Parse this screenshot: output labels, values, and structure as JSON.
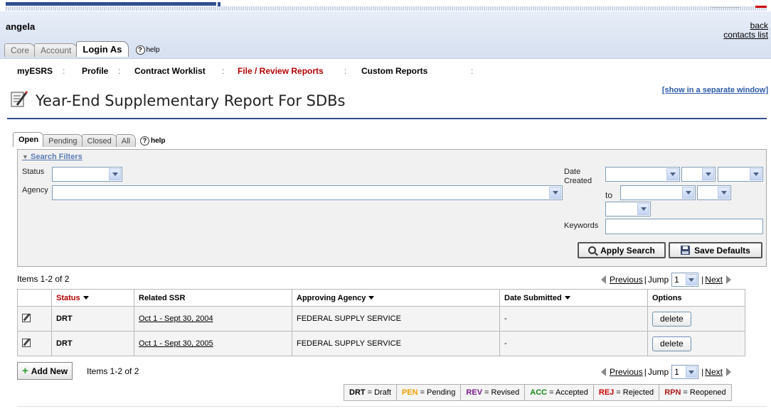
{
  "header": {
    "user_name": "angela",
    "back": "back",
    "contacts_list": "contacts list",
    "tabs": [
      {
        "label": "Core"
      },
      {
        "label": "Account"
      },
      {
        "label": "Login As"
      }
    ],
    "help": "help"
  },
  "nav": {
    "items": [
      {
        "label": "myESRS"
      },
      {
        "label": "Profile"
      },
      {
        "label": "Contract Worklist"
      },
      {
        "label": "File / Review Reports"
      },
      {
        "label": "Custom Reports"
      }
    ],
    "separator": ":"
  },
  "page": {
    "title": "Year-End Supplementary Report For SDBs",
    "separate_window": "[show in a separate window]"
  },
  "subtabs": {
    "items": [
      {
        "label": "Open"
      },
      {
        "label": "Pending"
      },
      {
        "label": "Closed"
      },
      {
        "label": "All"
      }
    ],
    "help": "help"
  },
  "filters": {
    "toggle": "Search Filters",
    "status_label": "Status",
    "agency_label": "Agency",
    "date_created_label": "Date Created",
    "to_label": "to",
    "keywords_label": "Keywords",
    "apply_search": "Apply Search",
    "save_defaults": "Save Defaults"
  },
  "pager": {
    "items_count": "Items 1-2 of 2",
    "previous": "Previous",
    "jump": "Jump",
    "jump_value": "1",
    "next": "Next"
  },
  "table": {
    "headers": {
      "status": "Status",
      "related_ssr": "Related SSR",
      "approving_agency": "Approving Agency",
      "date_submitted": "Date Submitted",
      "options": "Options"
    },
    "rows": [
      {
        "status": "DRT",
        "related_ssr": "Oct 1 - Sept 30, 2004",
        "approving_agency": "FEDERAL SUPPLY SERVICE",
        "date_submitted": "-",
        "action": "delete"
      },
      {
        "status": "DRT",
        "related_ssr": "Oct 1 - Sept 30, 2005",
        "approving_agency": "FEDERAL SUPPLY SERVICE",
        "date_submitted": "-",
        "action": "delete"
      }
    ]
  },
  "footer": {
    "add_new": "Add New",
    "items_count": "Items 1-2 of 2"
  },
  "legend": [
    {
      "code": "DRT",
      "text": "= Draft",
      "color": "#000000"
    },
    {
      "code": "PEN",
      "text": "= Pending",
      "color": "#f0a000"
    },
    {
      "code": "REV",
      "text": "= Revised",
      "color": "#7a1a8a"
    },
    {
      "code": "ACC",
      "text": "= Accepted",
      "color": "#1a8a1a"
    },
    {
      "code": "REJ",
      "text": "= Rejected",
      "color": "#cc0000"
    },
    {
      "code": "RPN",
      "text": "= Reopened",
      "color": "#aa1a1a"
    }
  ],
  "colors": {
    "accent_blue": "#2f4f8f",
    "nav_current": "#b30000",
    "link_blue": "#2b5aa8"
  }
}
